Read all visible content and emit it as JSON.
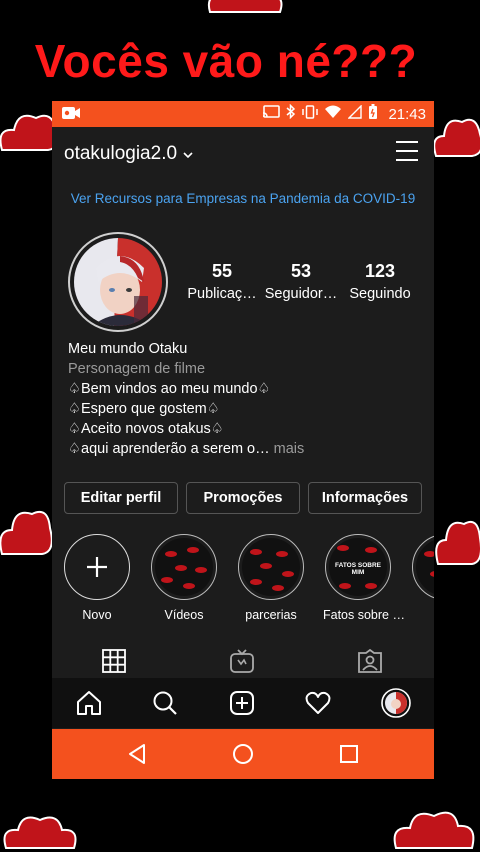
{
  "overlay_caption": "Vocês vão né???",
  "status_bar": {
    "time": "21:43"
  },
  "app_bar": {
    "username": "otakulogia2.0"
  },
  "business_banner": "Ver Recursos para Empresas na Pandemia da COVID-19",
  "profile": {
    "stats": [
      {
        "value": "55",
        "label": "Publicaç…"
      },
      {
        "value": "53",
        "label": "Seguidor…"
      },
      {
        "value": "123",
        "label": "Seguindo"
      }
    ],
    "display_name": "Meu mundo Otaku",
    "category": "Personagem de filme",
    "bio_lines": [
      "♤Bem vindos ao meu mundo♤",
      "♤Espero que gostem♤",
      "♤Aceito novos otakus♤",
      "♤aqui aprenderão a serem o…"
    ],
    "bio_more": " mais"
  },
  "actions": {
    "edit_profile": "Editar perfil",
    "promotions": "Promoções",
    "info": "Informações"
  },
  "highlights": [
    {
      "label": "Novo"
    },
    {
      "label": "Vídeos"
    },
    {
      "label": "parcerias"
    },
    {
      "label": "Fatos sobre …",
      "cover_text": "FATOS SOBRE MIM"
    },
    {
      "label": "m"
    }
  ],
  "colors": {
    "accent": "#f4511e",
    "link": "#4ba3f0",
    "overlay_text": "#ff1a1a",
    "background": "#1c1c1c"
  },
  "icons": {
    "tabs": [
      "grid-icon",
      "igtv-icon",
      "tagged-icon"
    ],
    "bottom_nav": [
      "home-icon",
      "search-icon",
      "add-post-icon",
      "heart-icon",
      "profile-avatar"
    ],
    "android_nav": [
      "back-icon",
      "home-circle-icon",
      "recents-icon"
    ]
  }
}
